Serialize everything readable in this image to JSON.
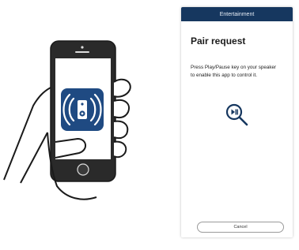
{
  "app_bar": {
    "title": "Entertainment"
  },
  "pair_request": {
    "heading": "Pair request",
    "instruction_line1": "Press Play/Pause key on your speaker",
    "instruction_line2": "to enable this app to control it.",
    "cancel_label": "Cancel"
  },
  "icons": {
    "illustration_app": "speaker-wireless-icon",
    "play_pause_search": "play-pause-search-icon"
  },
  "colors": {
    "app_bar": "#16375f",
    "app_icon_background": "#1f4a82",
    "accent": "#16375f",
    "phone_body": "#2a2a2a",
    "skin": "#ffffff",
    "outline": "#1a1a1a"
  }
}
